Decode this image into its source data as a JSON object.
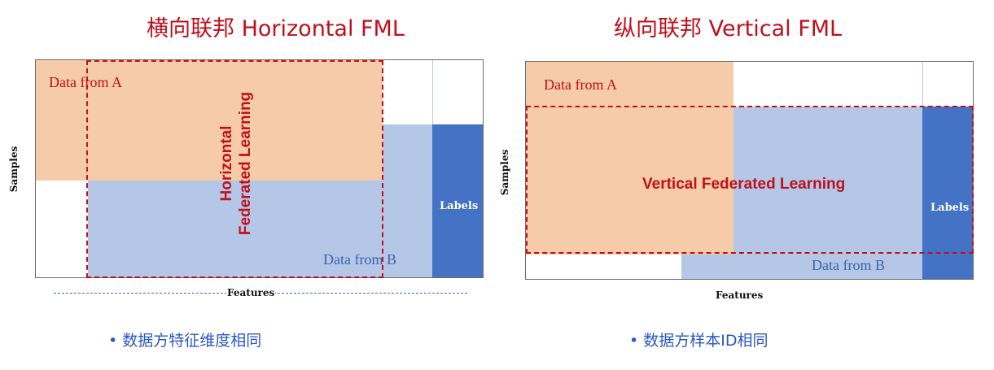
{
  "left": {
    "title": "横向联邦 Horizontal FML",
    "data_a": "Data from A",
    "data_b": "Data from B",
    "labels": "Labels",
    "samples": "Samples",
    "features": "Features",
    "fed_line1": "Horizontal",
    "fed_line2": "Federated Learning",
    "bullet": "•   数据方特征维度相同"
  },
  "right": {
    "title": "纵向联邦 Vertical FML",
    "data_a": "Data from A",
    "data_b": "Data from B",
    "labels": "Labels",
    "samples": "Samples",
    "features": "Features",
    "fed": "Vertical Federated Learning",
    "bullet": "•   数据方样本ID相同"
  },
  "colors": {
    "title_red": "#c0101c",
    "party_a": "#f6cba9",
    "party_b": "#b4c7e7",
    "labels": "#4472c4",
    "bullet_blue": "#2b56c8"
  }
}
